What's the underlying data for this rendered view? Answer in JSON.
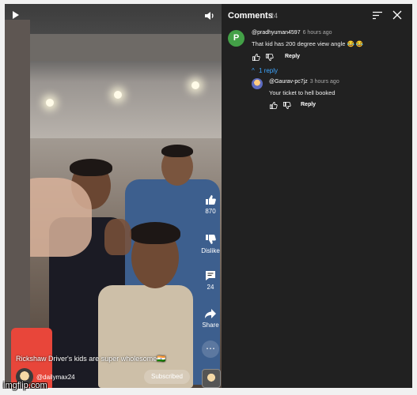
{
  "video": {
    "like_count": "870",
    "dislike_label": "Dislike",
    "comment_count": "24",
    "share_label": "Share",
    "caption": "Rickshaw Driver's kids are super wholesome🇮🇳",
    "channel_name": "@dailymax24",
    "subscribe_label": "Subscribed"
  },
  "comments_panel": {
    "title": "Comments",
    "count": "24",
    "comments": [
      {
        "avatar_letter": "P",
        "avatar_color": "#43a047",
        "author": "@pradhyuman4597",
        "time": "6 hours ago",
        "text": "That kid has 200 degree view angle 😂 😂",
        "reply_label": "Reply",
        "replies_toggle": "1 reply"
      }
    ],
    "replies": [
      {
        "author": "@Gaurav-pc7jz",
        "time": "3 hours ago",
        "text": "Your ticket to hell booked",
        "reply_label": "Reply"
      }
    ]
  },
  "watermark": "imgflip.com",
  "colors": {
    "panel_bg": "#212121",
    "accent_link": "#3ea6ff",
    "page_bg": "#f1f1f1"
  }
}
